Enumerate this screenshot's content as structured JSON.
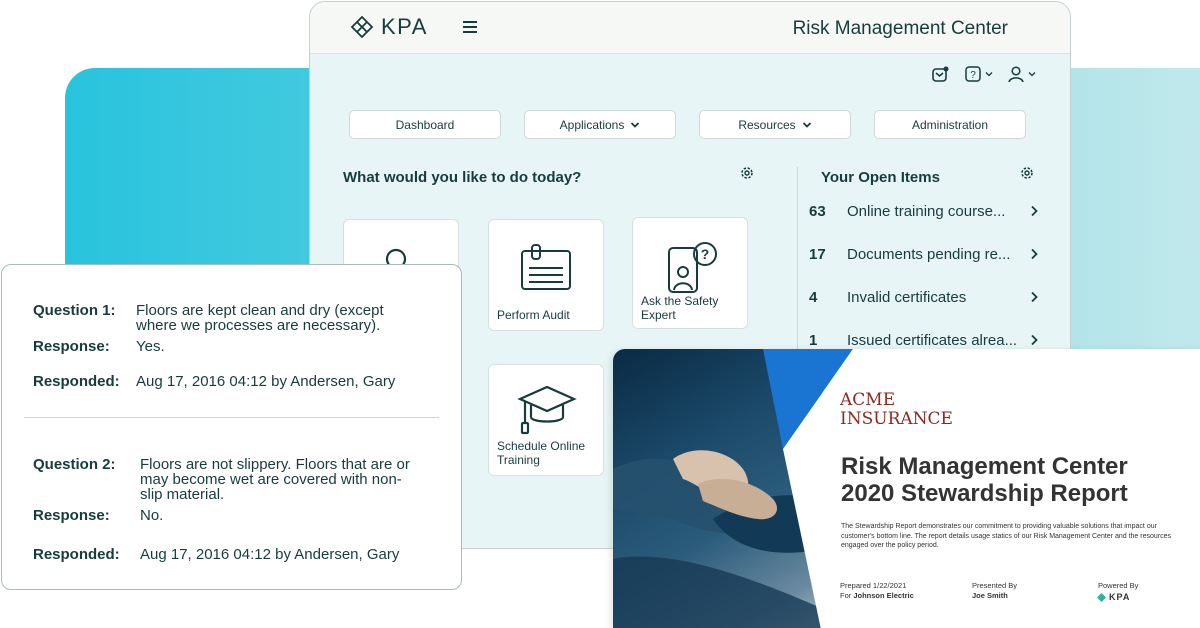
{
  "app": {
    "logo_text": "KPA",
    "title": "Risk Management Center",
    "nav": [
      {
        "label": "Dashboard",
        "has_dropdown": false
      },
      {
        "label": "Applications",
        "has_dropdown": true
      },
      {
        "label": "Resources",
        "has_dropdown": true
      },
      {
        "label": "Administration",
        "has_dropdown": false
      }
    ],
    "prompt": "What would you like to do today?",
    "tiles": [
      {
        "label": "Perform Audit",
        "icon": "clipboard-icon"
      },
      {
        "label": "Ask the Safety Expert",
        "icon": "safety-expert-icon"
      },
      {
        "label": "Schedule Online Training",
        "icon": "graduation-cap-icon"
      }
    ],
    "open_items_title": "Your Open Items",
    "open_items": [
      {
        "count": "63",
        "label": "Online training course..."
      },
      {
        "count": "17",
        "label": "Documents pending re..."
      },
      {
        "count": "4",
        "label": "Invalid certificates"
      },
      {
        "count": "1",
        "label": "Issued certificates alrea..."
      }
    ]
  },
  "questions": [
    {
      "q_label": "Question 1:",
      "q_text_line1": "Floors are kept clean and dry (except",
      "q_text_line2": "where we processes are necessary).",
      "r_label": "Response:",
      "r_text": "Yes.",
      "d_label": "Responded:",
      "d_text": "Aug 17, 2016 04:12 by Andersen, Gary"
    },
    {
      "q_label": "Question 2:",
      "q_text_line1": "Floors are not slippery. Floors that are or",
      "q_text_line2": "may become wet are covered with non-",
      "q_text_line3": "slip material.",
      "r_label": "Response:",
      "r_text": "No.",
      "d_label": "Responded:",
      "d_text": "Aug 17, 2016 04:12 by Andersen, Gary"
    }
  ],
  "report": {
    "brand_line1": "ACME",
    "brand_line2": "INSURANCE",
    "title_line1": "Risk Management Center",
    "title_line2": "2020 Stewardship Report",
    "description": "The Stewardship Report demonstrates our commitment to providing valuable solutions that impact our customer's bottom line. The report details usage statics of our Risk Management Center and the resources engaged over the policy period.",
    "prepared_label": "Prepared 1/22/2021",
    "for_label": "For",
    "for_value": "Johnson Electric",
    "presented_label": "Presented By",
    "presented_value": "Joe Smith",
    "powered_label": "Powered By",
    "powered_value": "KPA"
  },
  "colors": {
    "brand_dark": "#173c3c",
    "accent_teal": "#29c3dd",
    "acme_red": "#8c2a1d"
  }
}
